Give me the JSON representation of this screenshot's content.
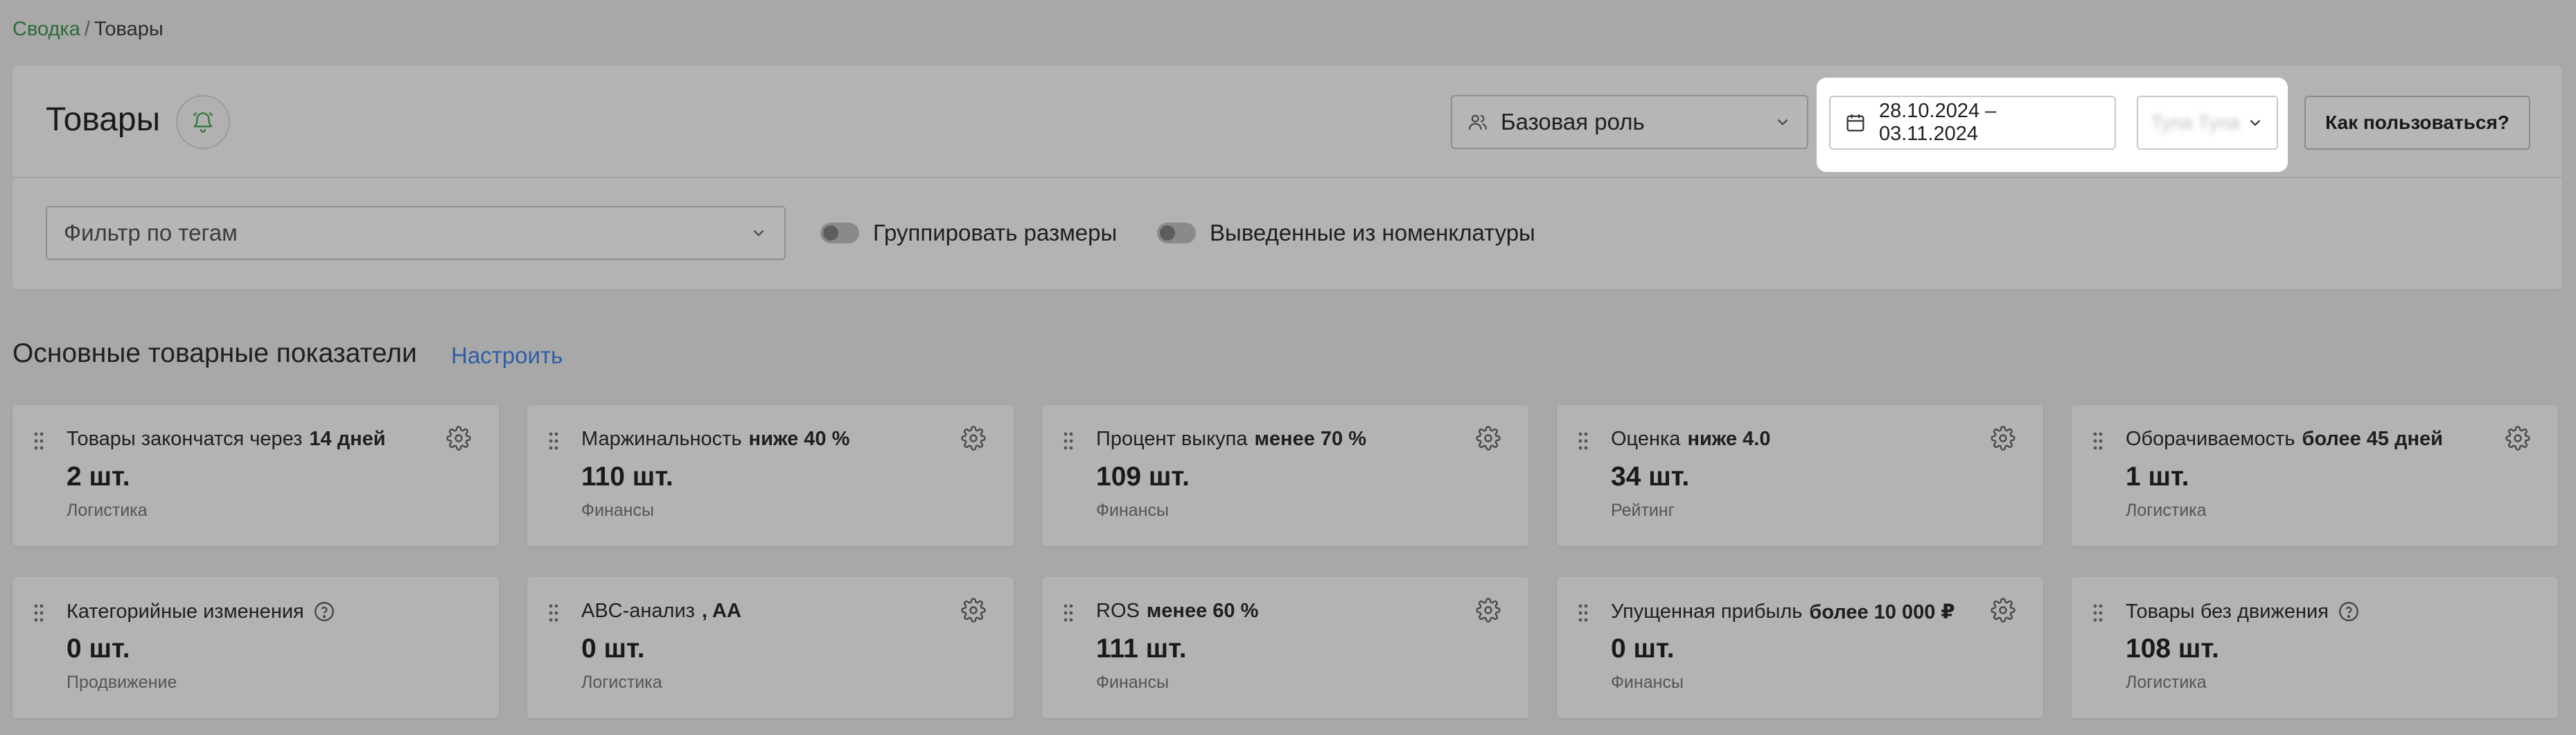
{
  "breadcrumb": {
    "link": "Сводка",
    "separator": "/",
    "current": "Товары"
  },
  "header": {
    "title": "Товары",
    "role_select": "Базовая роль",
    "date_range": "28.10.2024 – 03.11.2024",
    "store_select": "Тупа Тупа",
    "help_button": "Как пользоваться?"
  },
  "filters": {
    "tag_filter_placeholder": "Фильтр по тегам",
    "group_sizes": "Группировать размеры",
    "removed_items": "Выведенные из номенклатуры"
  },
  "section": {
    "title": "Основные товарные показатели",
    "configure_link": "Настроить"
  },
  "cards": [
    {
      "title": "Товары закончатся через",
      "condition": "14 дней",
      "value": "2 шт.",
      "category": "Логистика",
      "help": false
    },
    {
      "title": "Маржинальность",
      "condition": "ниже 40 %",
      "value": "110 шт.",
      "category": "Финансы",
      "help": false
    },
    {
      "title": "Процент выкупа",
      "condition": "менее 70 %",
      "value": "109 шт.",
      "category": "Финансы",
      "help": false
    },
    {
      "title": "Оценка",
      "condition": "ниже 4.0",
      "value": "34 шт.",
      "category": "Рейтинг",
      "help": false
    },
    {
      "title": "Оборачиваемость",
      "condition": "более 45 дней",
      "value": "1 шт.",
      "category": "Логистика",
      "help": false
    },
    {
      "title": "Категорийные изменения",
      "condition": "",
      "value": "0 шт.",
      "category": "Продвижение",
      "help": true
    },
    {
      "title": "ABC-анализ",
      "condition": ", AA",
      "value": "0 шт.",
      "category": "Логистика",
      "help": false
    },
    {
      "title": "ROS",
      "condition": "менее 60 %",
      "value": "111 шт.",
      "category": "Финансы",
      "help": false
    },
    {
      "title": "Упущенная прибыль",
      "condition": "более 10 000 ₽",
      "value": "0 шт.",
      "category": "Финансы",
      "help": false
    },
    {
      "title": "Товары без движения",
      "condition": "",
      "value": "108 шт.",
      "category": "Логистика",
      "help": true
    }
  ],
  "icons": {
    "bell": "bell-icon",
    "users": "users-icon",
    "calendar": "calendar-icon",
    "chevron": "chevron-down-icon",
    "drag": "drag-handle-icon",
    "gear": "gear-icon",
    "help": "question-circle-icon"
  },
  "colors": {
    "link_green": "#2e6b3a",
    "link_blue": "#2f5ea6",
    "overlay": "#a8a8a8"
  }
}
